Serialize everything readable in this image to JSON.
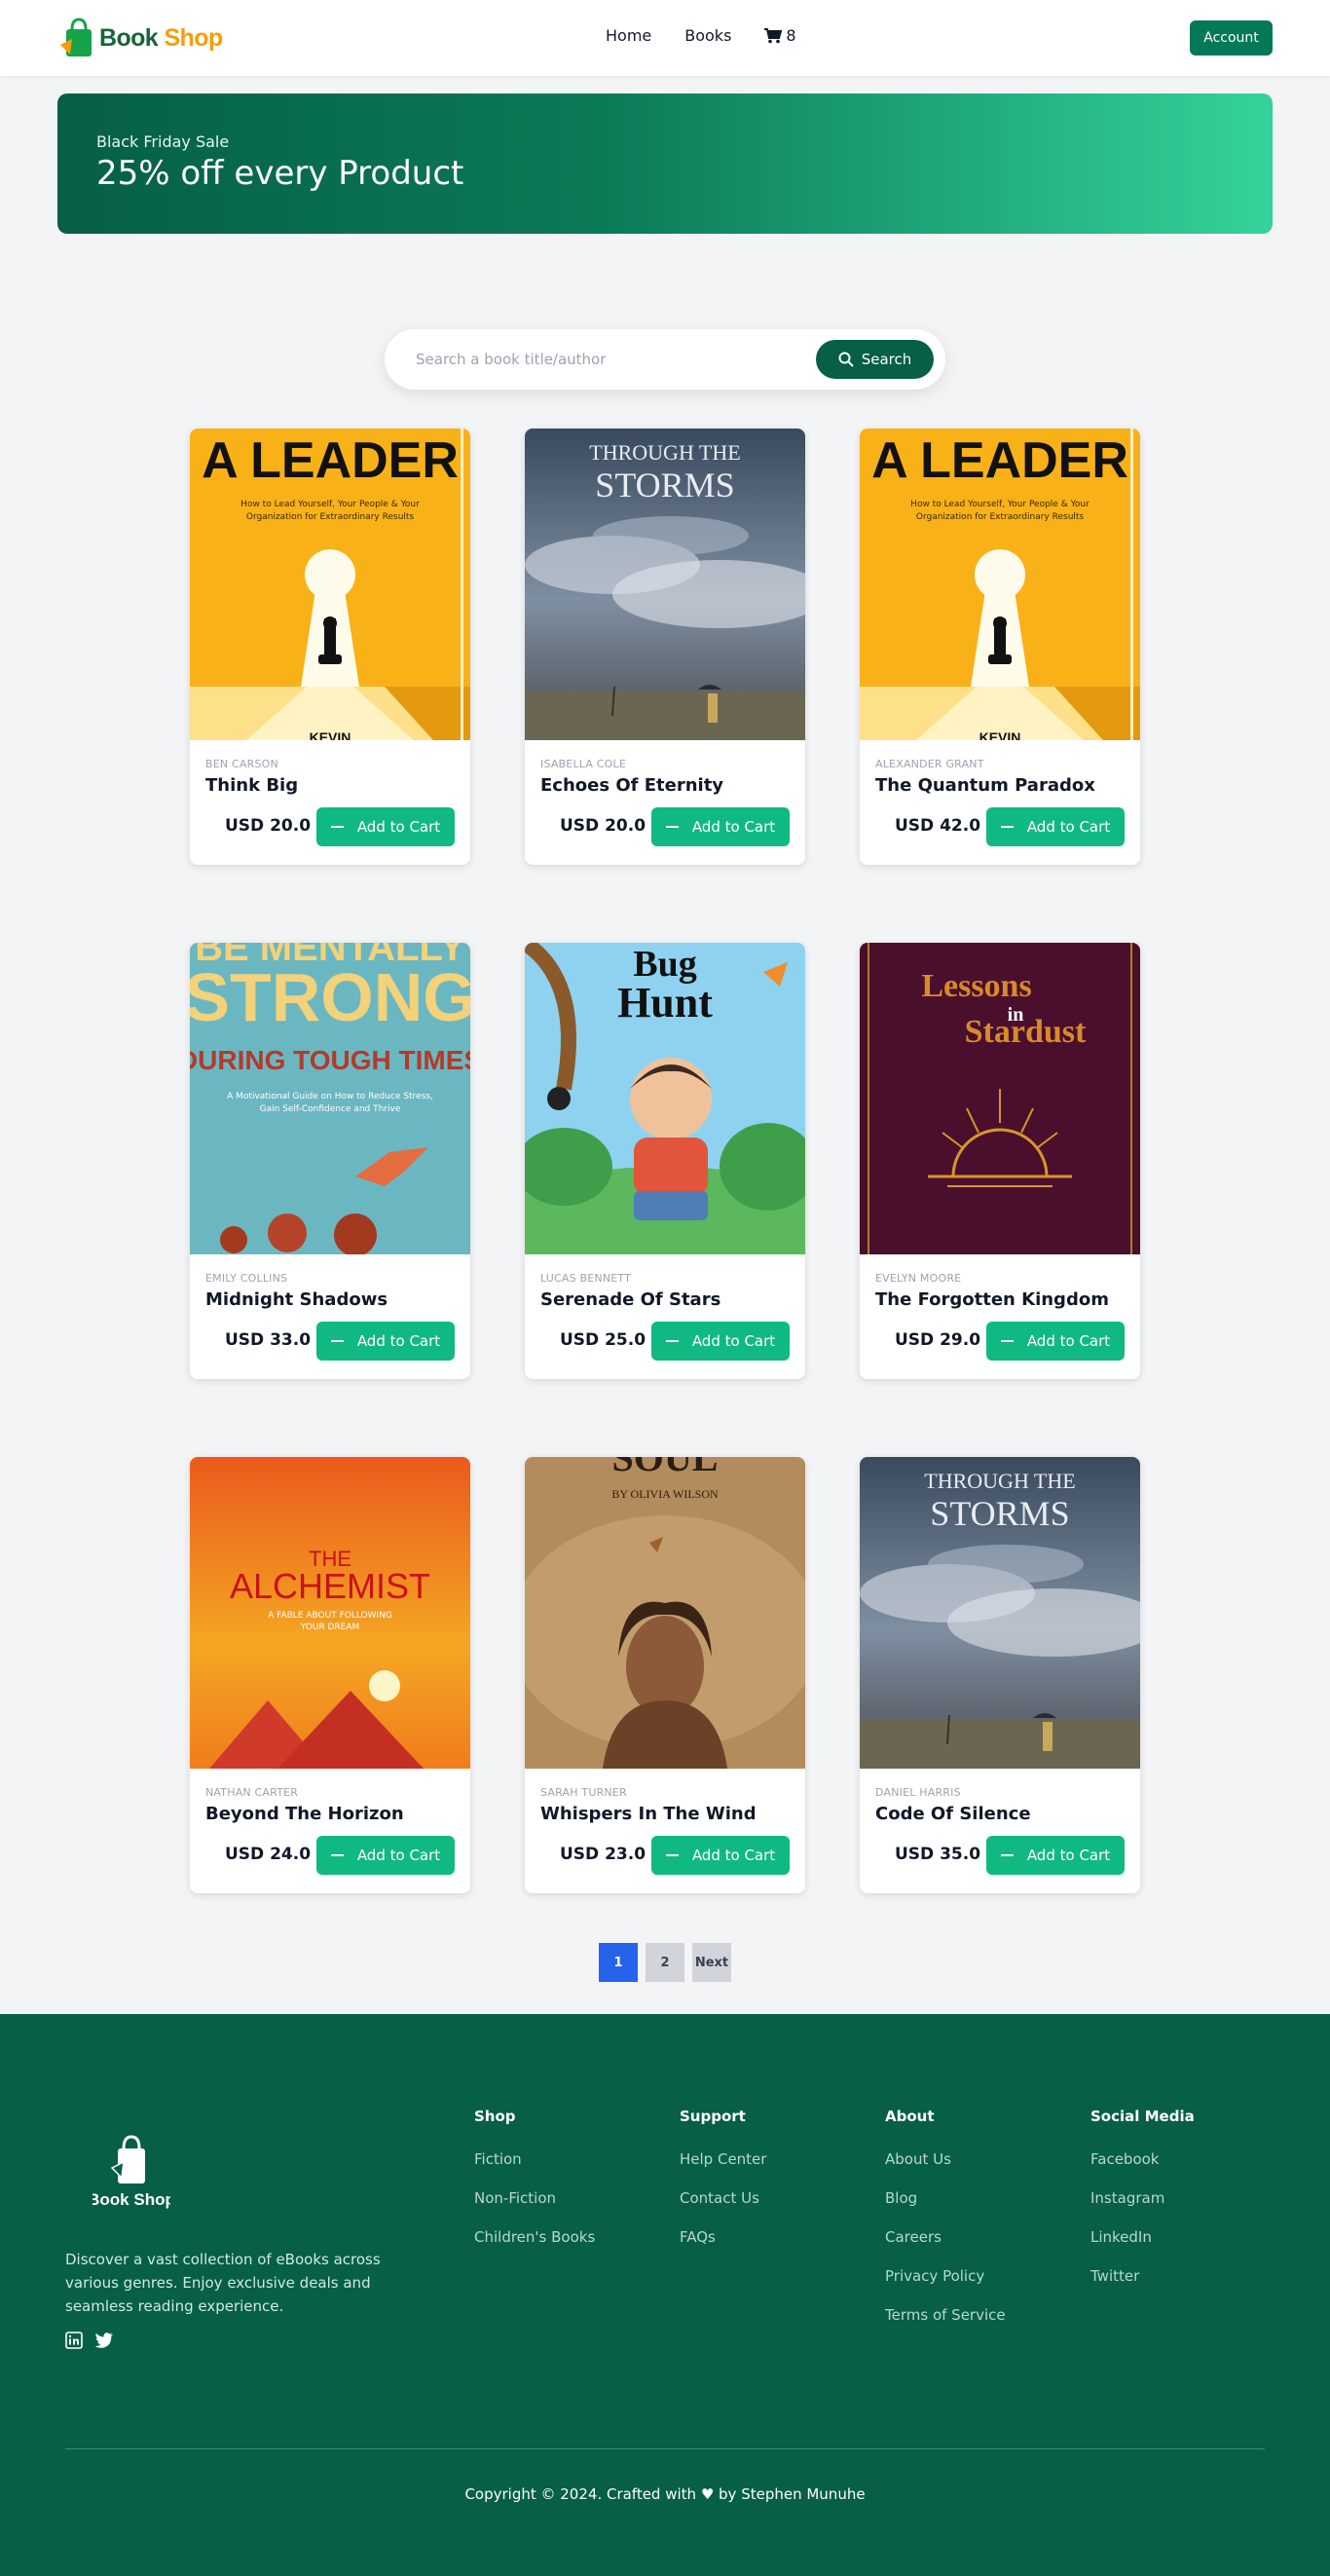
{
  "header": {
    "logo_word1": "Book",
    "logo_word2": "Shop",
    "nav": [
      "Home",
      "Books"
    ],
    "cart_count": "8",
    "account_label": "Account"
  },
  "banner": {
    "eyebrow": "Black Friday Sale",
    "headline": "25% off every Product"
  },
  "search": {
    "placeholder": "Search a book title/author",
    "button_label": "Search"
  },
  "add_to_cart_label": "Add to Cart",
  "books": [
    {
      "author": "BEN CARSON",
      "title": "Think Big",
      "price": "USD 20.0",
      "cover": "leader"
    },
    {
      "author": "ISABELLA COLE",
      "title": "Echoes Of Eternity",
      "price": "USD 20.0",
      "cover": "storms"
    },
    {
      "author": "ALEXANDER GRANT",
      "title": "The Quantum Paradox",
      "price": "USD 42.0",
      "cover": "leader"
    },
    {
      "author": "EMILY COLLINS",
      "title": "Midnight Shadows",
      "price": "USD 33.0",
      "cover": "strong"
    },
    {
      "author": "LUCAS BENNETT",
      "title": "Serenade Of Stars",
      "price": "USD 25.0",
      "cover": "bughunt"
    },
    {
      "author": "EVELYN MOORE",
      "title": "The Forgotten Kingdom",
      "price": "USD 29.0",
      "cover": "stardust"
    },
    {
      "author": "NATHAN CARTER",
      "title": "Beyond The Horizon",
      "price": "USD 24.0",
      "cover": "alchemist"
    },
    {
      "author": "SARAH TURNER",
      "title": "Whispers In The Wind",
      "price": "USD 23.0",
      "cover": "soul"
    },
    {
      "author": "DANIEL HARRIS",
      "title": "Code Of Silence",
      "price": "USD 35.0",
      "cover": "storms"
    }
  ],
  "cover_text": {
    "leader_title": "A LEADER",
    "leader_sub1": "How to Lead Yourself, Your People & Your",
    "leader_sub2": "Organization for Extraordinary Results",
    "leader_author_cut": "KEVIN",
    "storms_top": "THROUGH THE",
    "storms_big": "STORMS",
    "strong_top": "BE MENTALLY",
    "strong_big": "STRONG",
    "strong_mid": "DURING TOUGH TIMES",
    "strong_sub1": "A Motivational Guide on How to Reduce Stress,",
    "strong_sub2": "Gain Self-Confidence and Thrive",
    "bug_1": "Bug",
    "bug_2": "Hunt",
    "stardust_1": "Lessons",
    "stardust_2": "in",
    "stardust_3": "Stardust",
    "alch_1": "THE",
    "alch_2": "ALCHEMIST",
    "alch_3": "A FABLE ABOUT FOLLOWING",
    "alch_4": "YOUR DREAM",
    "soul_1": "SOUL",
    "soul_2": "BY OLIVIA WILSON"
  },
  "pagination": {
    "pages": [
      "1",
      "2"
    ],
    "next_label": "Next",
    "active": "1"
  },
  "footer": {
    "logo_text": "Book Shop",
    "description": "Discover a vast collection of eBooks across various genres. Enjoy exclusive deals and seamless reading experience.",
    "columns": [
      {
        "heading": "Shop",
        "items": [
          "Fiction",
          "Non-Fiction",
          "Children's Books"
        ]
      },
      {
        "heading": "Support",
        "items": [
          "Help Center",
          "Contact Us",
          "FAQs"
        ]
      },
      {
        "heading": "About",
        "items": [
          "About Us",
          "Blog",
          "Careers",
          "Privacy Policy",
          "Terms of Service"
        ]
      },
      {
        "heading": "Social Media",
        "items": [
          "Facebook",
          "Instagram",
          "LinkedIn",
          "Twitter"
        ]
      }
    ],
    "copyright": "Copyright © 2024. Crafted with ♥ by Stephen Munuhe"
  },
  "colors": {
    "brand_green": "#065f46",
    "button_green": "#10b981",
    "active_page": "#2563eb"
  }
}
